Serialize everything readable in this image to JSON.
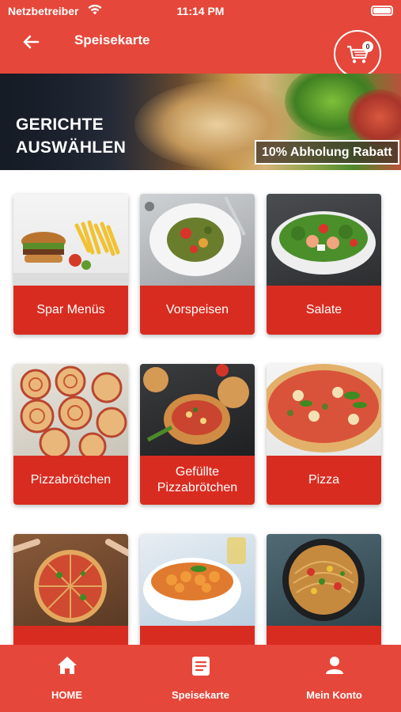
{
  "status_bar": {
    "carrier": "Netzbetreiber",
    "time": "11:14 PM"
  },
  "header": {
    "title": "Speisekarte",
    "cart_count": "0"
  },
  "banner": {
    "title": "GERICHTE AUSWÄHLEN",
    "tag": "10% Abholung Rabatt"
  },
  "categories": [
    {
      "label": "Spar Menüs"
    },
    {
      "label": "Vorspeisen"
    },
    {
      "label": "Salate"
    },
    {
      "label": "Pizzabrötchen"
    },
    {
      "label": "Gefüllte Pizzabrötchen"
    },
    {
      "label": "Pizza"
    },
    {
      "label": ""
    },
    {
      "label": ""
    },
    {
      "label": ""
    }
  ],
  "tabbar": {
    "home": "HOME",
    "menu": "Speisekarte",
    "account": "Mein Konto"
  },
  "colors": {
    "primary": "#e5473a",
    "card_label": "#d92c20",
    "text_on_primary": "#ffffff"
  },
  "icons": [
    "wifi-icon",
    "battery-icon",
    "back-arrow-icon",
    "cart-icon",
    "home-icon",
    "menu-book-icon",
    "person-icon"
  ]
}
